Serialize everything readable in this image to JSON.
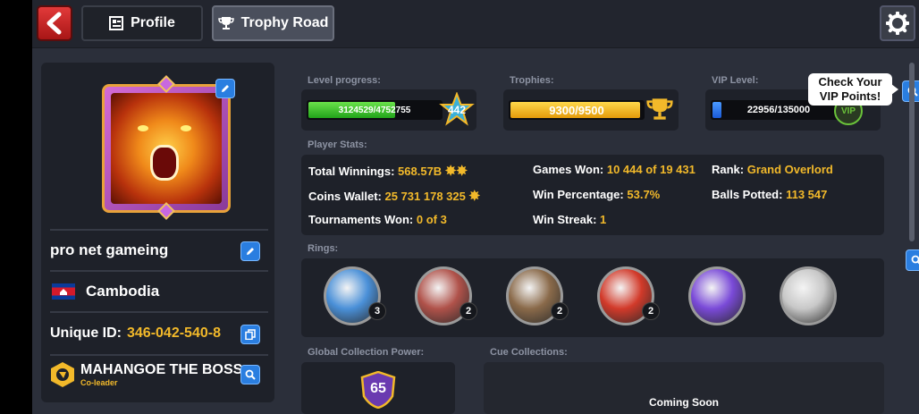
{
  "tabs": {
    "profile": "Profile",
    "trophy_road": "Trophy Road"
  },
  "player": {
    "name": "pro net gameing",
    "country": "Cambodia",
    "unique_id_label": "Unique ID:",
    "unique_id": "346-042-540-8",
    "club_name": "MAHANGOE THE BOSS",
    "club_role": "Co-leader"
  },
  "level": {
    "label": "Level progress:",
    "progress_text": "3124529/4752755",
    "progress_fraction": 0.657,
    "level": "442"
  },
  "trophies": {
    "label": "Trophies:",
    "text": "9300/9500",
    "fraction": 0.979
  },
  "vip": {
    "label": "VIP Level:",
    "text": "22956/135000",
    "fraction": 0.17,
    "badge": "VIP",
    "tooltip_line1": "Check Your",
    "tooltip_line2": "VIP Points!"
  },
  "stats": {
    "label": "Player Stats:",
    "total_winnings_label": "Total Winnings:",
    "total_winnings": "568.57B",
    "coins_wallet_label": "Coins Wallet:",
    "coins_wallet": "25 731 178 325",
    "tournaments_won_label": "Tournaments Won:",
    "tournaments_won": "0 of 3",
    "games_won_label": "Games Won:",
    "games_won": "10 444 of 19 431",
    "win_percentage_label": "Win Percentage:",
    "win_percentage": "53.7%",
    "win_streak_label": "Win Streak:",
    "win_streak": "1",
    "rank_label": "Rank:",
    "rank": "Grand Overlord",
    "balls_potted_label": "Balls Potted:",
    "balls_potted": "113 547"
  },
  "rings": {
    "label": "Rings:",
    "items": [
      {
        "count": "3",
        "color": "#4a90d8"
      },
      {
        "count": "2",
        "color": "#b0524a"
      },
      {
        "count": "2",
        "color": "#8a6a4a"
      },
      {
        "count": "2",
        "color": "#d23a2a"
      },
      {
        "count": "",
        "color": "#7a4ad8"
      },
      {
        "count": "",
        "color": "#c8c8c8"
      }
    ]
  },
  "global_collection": {
    "label": "Global Collection Power:",
    "value": "65"
  },
  "cue_collections": {
    "label": "Cue Collections:",
    "status": "Coming Soon"
  },
  "colors": {
    "accent_gold": "#f2b92a",
    "accent_blue": "#2a7ee0",
    "back_red": "#d42a2a"
  },
  "icons": [
    "back-arrow-icon",
    "profile-card-icon",
    "trophy-icon",
    "gear-icon",
    "edit-pencil-icon",
    "copy-icon",
    "search-icon",
    "star-level-icon",
    "coins-icon"
  ]
}
